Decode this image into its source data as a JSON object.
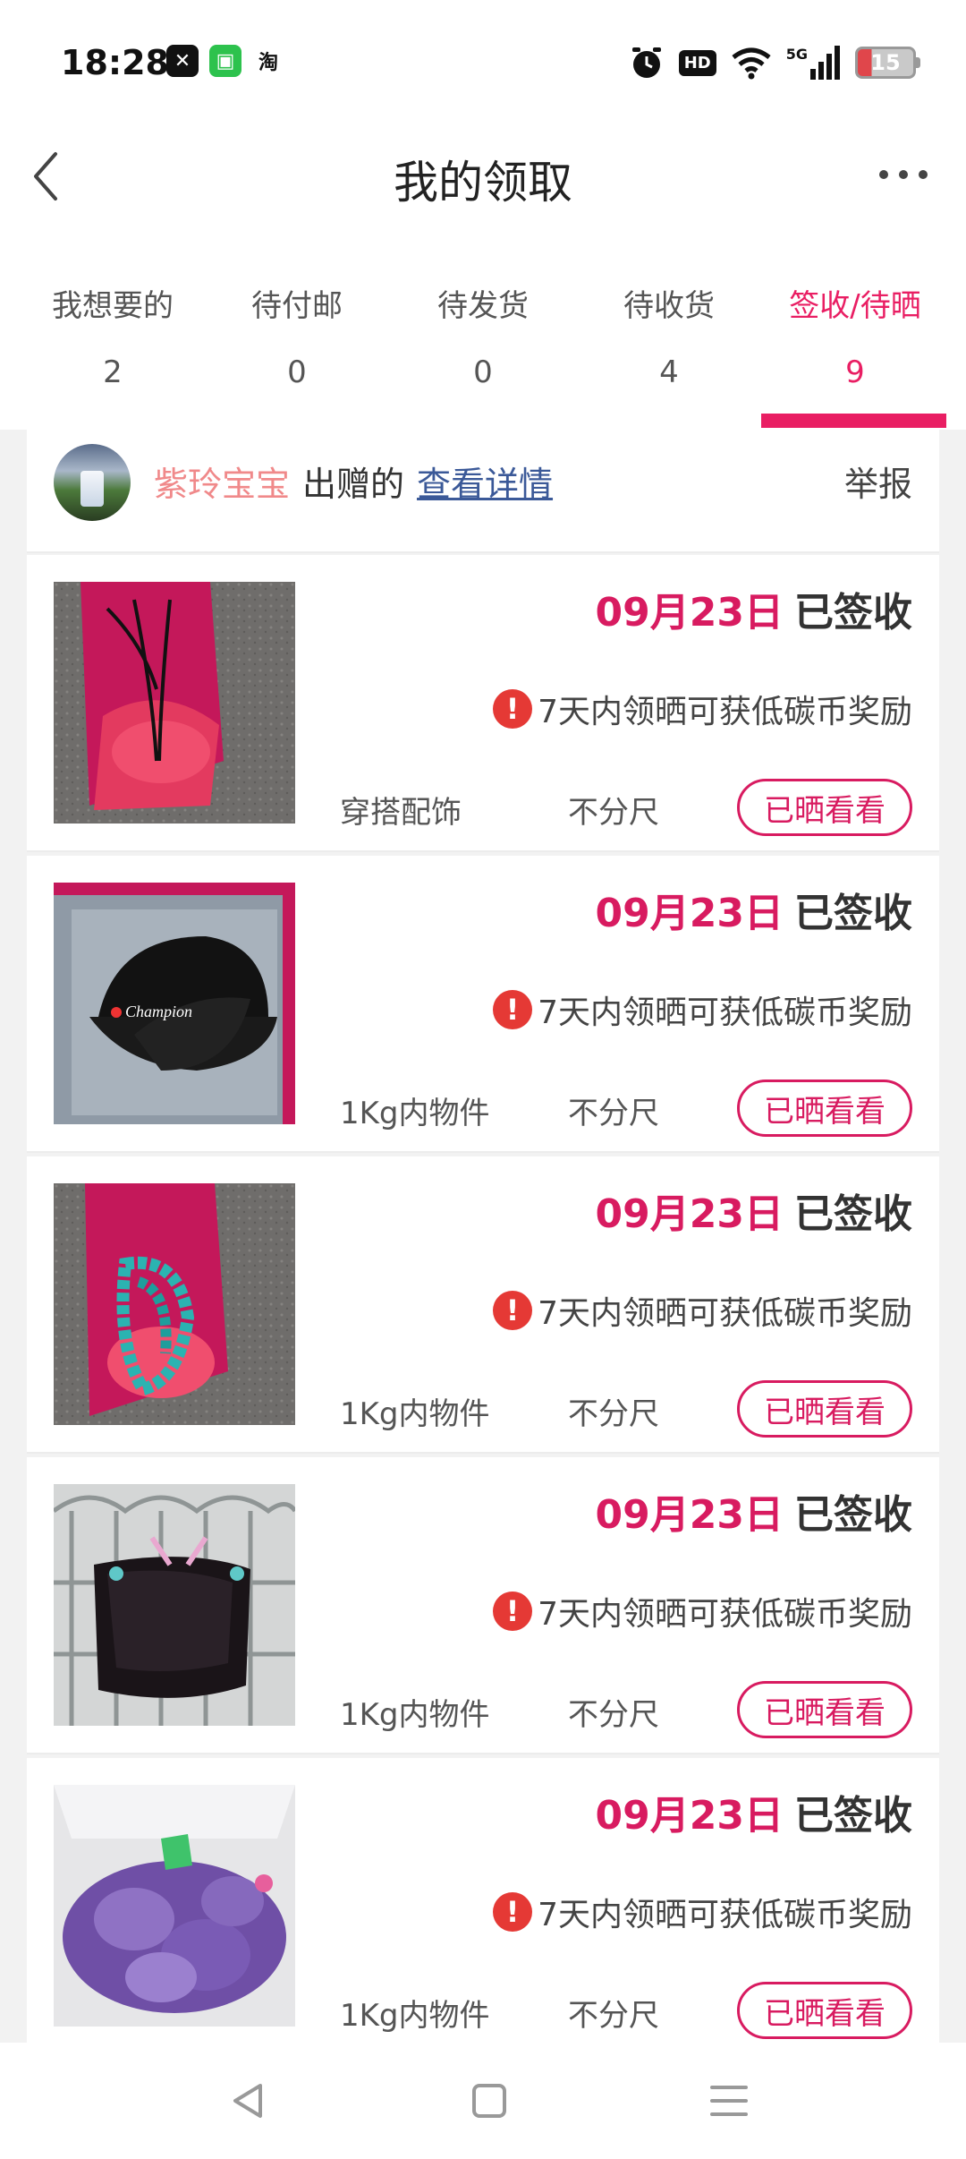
{
  "status_bar": {
    "time": "18:28",
    "app_icons": [
      "capcut-icon",
      "wechat-icon",
      "taobao-icon"
    ],
    "taobao_text": "淘",
    "hd_text": "HD",
    "network_text": "5G",
    "battery_level": "15"
  },
  "header": {
    "title": "我的领取"
  },
  "tabs": [
    {
      "label": "我想要的",
      "count": "2"
    },
    {
      "label": "待付邮",
      "count": "0"
    },
    {
      "label": "待发货",
      "count": "0"
    },
    {
      "label": "待收货",
      "count": "4"
    },
    {
      "label": "签收/待晒",
      "count": "9"
    }
  ],
  "active_tab_index": 4,
  "donor": {
    "name": "紫玲宝宝",
    "verb": "出赠的",
    "detail_link": "查看详情",
    "report": "举报"
  },
  "items": [
    {
      "date": "09月23日",
      "status": "已签收",
      "notice": "7天内领晒可获低碳币奖励",
      "category": "穿搭配饰",
      "size": "不分尺",
      "button": "已晒看看"
    },
    {
      "date": "09月23日",
      "status": "已签收",
      "notice": "7天内领晒可获低碳币奖励",
      "category": "1Kg内物件",
      "size": "不分尺",
      "button": "已晒看看"
    },
    {
      "date": "09月23日",
      "status": "已签收",
      "notice": "7天内领晒可获低碳币奖励",
      "category": "1Kg内物件",
      "size": "不分尺",
      "button": "已晒看看"
    },
    {
      "date": "09月23日",
      "status": "已签收",
      "notice": "7天内领晒可获低碳币奖励",
      "category": "1Kg内物件",
      "size": "不分尺",
      "button": "已晒看看"
    },
    {
      "date": "09月23日",
      "status": "已签收",
      "notice": "7天内领晒可获低碳币奖励",
      "category": "1Kg内物件",
      "size": "不分尺",
      "button": "已晒看看"
    }
  ],
  "colors": {
    "accent": "#e91e63",
    "date_color": "#d81b60",
    "donor_name_color": "#f0898a",
    "link_color": "#3b5998",
    "warning_color": "#e53935"
  }
}
